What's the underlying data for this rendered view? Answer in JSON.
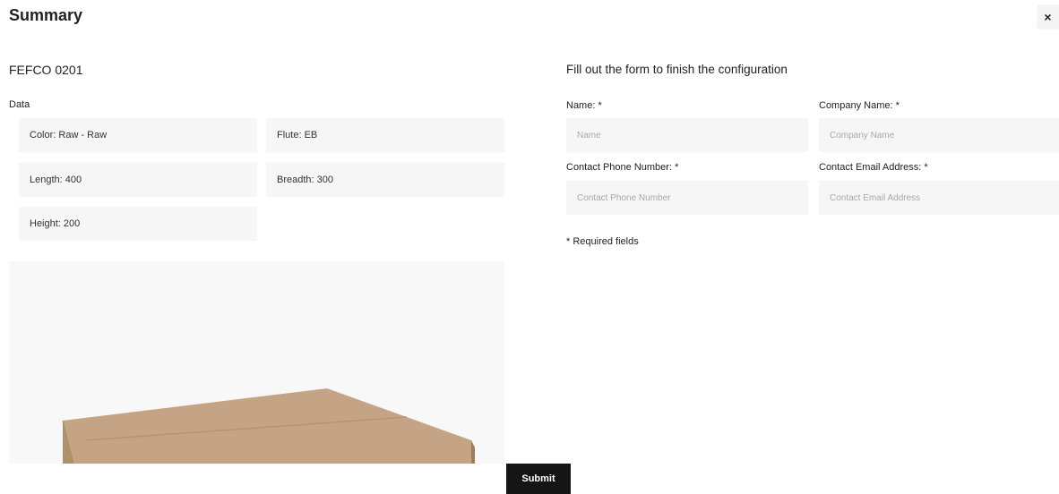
{
  "modal": {
    "title": "Summary",
    "close_label": "×"
  },
  "product": {
    "name": "FEFCO 0201",
    "data_label": "Data",
    "specs": [
      {
        "text": "Color: Raw - Raw"
      },
      {
        "text": "Flute: EB"
      },
      {
        "text": "Length: 400"
      },
      {
        "text": "Breadth: 300"
      },
      {
        "text": "Height: 200"
      }
    ],
    "preview_colors": {
      "background": "#f8f8f8",
      "box_top": "#c4a485",
      "box_side": "#b0916f",
      "box_edge": "#9c7e5e"
    }
  },
  "form": {
    "title": "Fill out the form to finish the configuration",
    "fields": {
      "name": {
        "label": "Name: *",
        "placeholder": "Name",
        "value": ""
      },
      "company": {
        "label": "Company Name: *",
        "placeholder": "Company Name",
        "value": ""
      },
      "phone": {
        "label": "Contact Phone Number: *",
        "placeholder": "Contact Phone Number",
        "value": ""
      },
      "email": {
        "label": "Contact Email Address: *",
        "placeholder": "Contact Email Address",
        "value": ""
      }
    },
    "required_note": "* Required fields",
    "submit_label": "Submit"
  }
}
